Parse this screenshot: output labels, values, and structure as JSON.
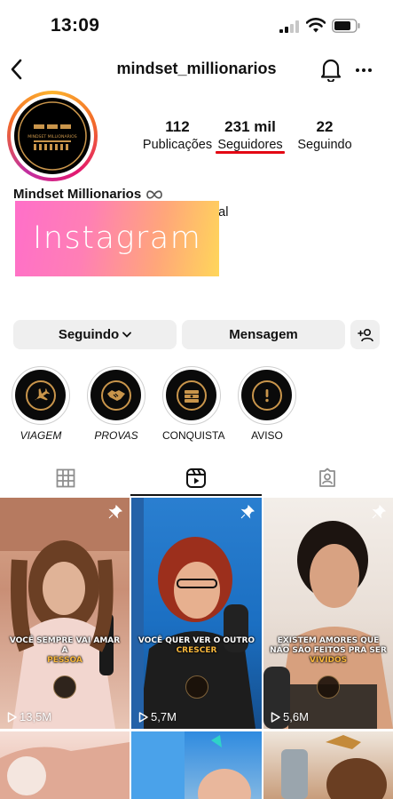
{
  "status_bar": {
    "time": "13:09"
  },
  "header": {
    "username": "mindset_millionarios"
  },
  "profile": {
    "avatar_text": "MINDSET MILLIONARIOS",
    "display_name": "Mindset Millionarios",
    "bio_fragment": "onal",
    "overlay_text": "Instagram"
  },
  "stats": {
    "posts": {
      "value": "112",
      "label": "Publicações"
    },
    "followers": {
      "value": "231 mil",
      "label": "Seguidores"
    },
    "following": {
      "value": "22",
      "label": "Seguindo"
    }
  },
  "buttons": {
    "following": "Seguindo",
    "message": "Mensagem"
  },
  "highlights": [
    {
      "label": "VIAGEM",
      "icon": "airplane-icon"
    },
    {
      "label": "PROVAS",
      "icon": "handshake-icon"
    },
    {
      "label": "CONQUISTA",
      "icon": "money-stack-icon"
    },
    {
      "label": "AVISO",
      "icon": "exclamation-icon"
    }
  ],
  "tabs": [
    {
      "name": "grid",
      "icon": "grid-icon"
    },
    {
      "name": "reels",
      "icon": "reels-icon",
      "active": true
    },
    {
      "name": "tagged",
      "icon": "tagged-icon"
    }
  ],
  "reels": [
    {
      "caption": "VOCÊ SEMPRE VAI AMAR A",
      "caption_highlight": "PESSOA",
      "views": "13,5M",
      "pinned": true
    },
    {
      "caption": "VOCÊ QUER VER O OUTRO",
      "caption_highlight": "CRESCER",
      "views": "5,7M",
      "pinned": true
    },
    {
      "caption": "EXISTEM AMORES QUE NÃO SÃO FEITOS PRA SER",
      "caption_highlight": "VIVIDOS",
      "views": "5,6M",
      "pinned": true
    }
  ],
  "colors": {
    "followers_underline": "#e30613",
    "highlight_gold": "#c9954b",
    "caption_accent": "#f6b63c"
  }
}
